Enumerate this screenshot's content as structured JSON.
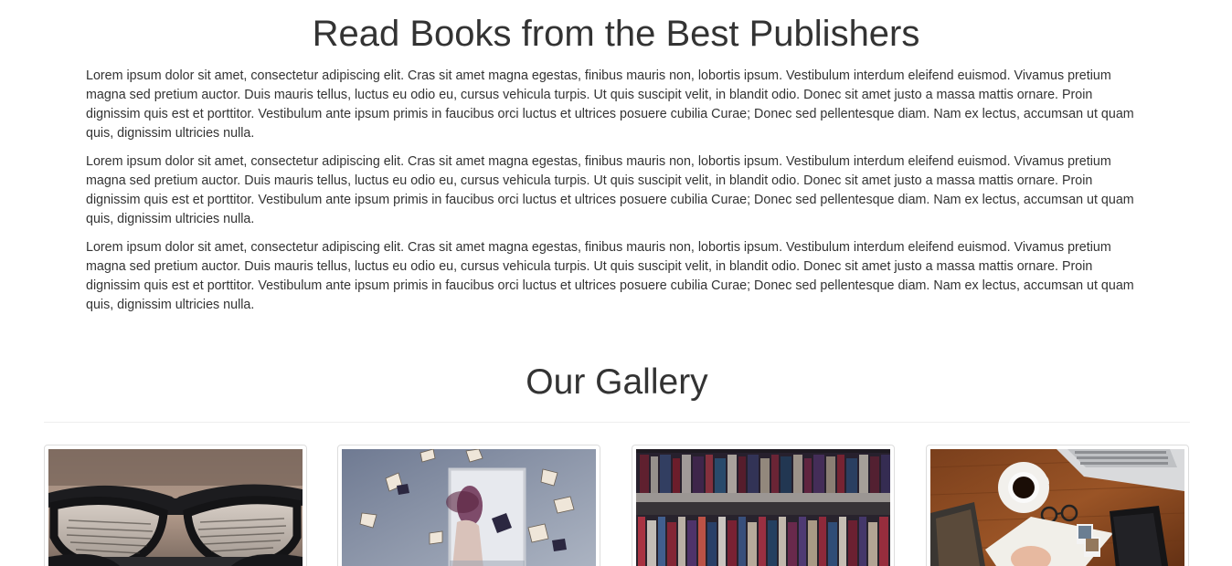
{
  "about": {
    "heading": "Read Books from the Best Publishers",
    "paragraphs": [
      "Lorem ipsum dolor sit amet, consectetur adipiscing elit. Cras sit amet magna egestas, finibus mauris non, lobortis ipsum. Vestibulum interdum eleifend euismod. Vivamus pretium magna sed pretium auctor. Duis mauris tellus, luctus eu odio eu, cursus vehicula turpis. Ut quis suscipit velit, in blandit odio. Donec sit amet justo a massa mattis ornare. Proin dignissim quis est et porttitor. Vestibulum ante ipsum primis in faucibus orci luctus et ultrices posuere cubilia Curae; Donec sed pellentesque diam. Nam ex lectus, accumsan ut quam quis, dignissim ultricies nulla.",
      "Lorem ipsum dolor sit amet, consectetur adipiscing elit. Cras sit amet magna egestas, finibus mauris non, lobortis ipsum. Vestibulum interdum eleifend euismod. Vivamus pretium magna sed pretium auctor. Duis mauris tellus, luctus eu odio eu, cursus vehicula turpis. Ut quis suscipit velit, in blandit odio. Donec sit amet justo a massa mattis ornare. Proin dignissim quis est et porttitor. Vestibulum ante ipsum primis in faucibus orci luctus et ultrices posuere cubilia Curae; Donec sed pellentesque diam. Nam ex lectus, accumsan ut quam quis, dignissim ultricies nulla.",
      "Lorem ipsum dolor sit amet, consectetur adipiscing elit. Cras sit amet magna egestas, finibus mauris non, lobortis ipsum. Vestibulum interdum eleifend euismod. Vivamus pretium magna sed pretium auctor. Duis mauris tellus, luctus eu odio eu, cursus vehicula turpis. Ut quis suscipit velit, in blandit odio. Donec sit amet justo a massa mattis ornare. Proin dignissim quis est et porttitor. Vestibulum ante ipsum primis in faucibus orci luctus et ultrices posuere cubilia Curae; Donec sed pellentesque diam. Nam ex lectus, accumsan ut quam quis, dignissim ultricies nulla."
    ]
  },
  "gallery": {
    "heading": "Our Gallery",
    "images": [
      {
        "subject": "reading-glasses-on-book"
      },
      {
        "subject": "woman-with-flying-books"
      },
      {
        "subject": "library-bookshelves"
      },
      {
        "subject": "desk-coffee-laptop-books"
      }
    ]
  },
  "colors": {
    "text": "#333333",
    "divider": "#eeeeee",
    "thumbnail_border": "#dddddd",
    "background": "#ffffff"
  }
}
